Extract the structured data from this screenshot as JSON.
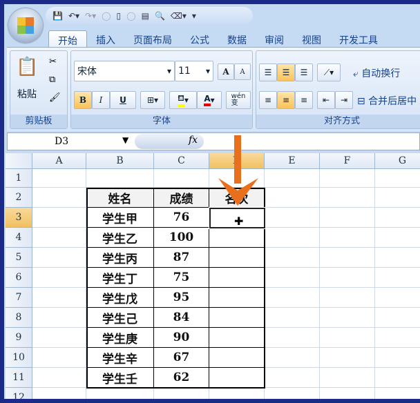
{
  "quick_access": {
    "icons": [
      "save-icon",
      "undo-icon",
      "redo-icon",
      "circle-icon",
      "new-icon",
      "open-icon",
      "form-icon",
      "print-preview-icon",
      "eraser-icon",
      "customize-icon"
    ]
  },
  "tabs": [
    "开始",
    "插入",
    "页面布局",
    "公式",
    "数据",
    "审阅",
    "视图",
    "开发工具"
  ],
  "ribbon": {
    "clipboard": {
      "label": "剪贴板",
      "paste": "粘贴"
    },
    "font": {
      "label": "字体",
      "name": "宋体",
      "size": "11",
      "bold": "B",
      "italic": "I",
      "underline": "U",
      "grow": "A",
      "shrink": "A",
      "color_a": "A",
      "phonetic": "wén\n变"
    },
    "alignment": {
      "label": "对齐方式",
      "wrap": "自动换行",
      "merge": "合并后居中"
    }
  },
  "formula_bar": {
    "name_box": "D3",
    "fx": "fx",
    "value": ""
  },
  "sheet": {
    "columns": [
      "A",
      "B",
      "C",
      "D",
      "E",
      "F",
      "G"
    ],
    "rows": [
      "1",
      "2",
      "3",
      "4",
      "5",
      "6",
      "7",
      "8",
      "9",
      "10",
      "11",
      "12"
    ],
    "selected_cell": "D3",
    "table": {
      "headers": [
        "姓名",
        "成绩",
        "名次"
      ],
      "rows": [
        [
          "学生甲",
          "76",
          ""
        ],
        [
          "学生乙",
          "100",
          ""
        ],
        [
          "学生丙",
          "87",
          ""
        ],
        [
          "学生丁",
          "75",
          ""
        ],
        [
          "学生戊",
          "95",
          ""
        ],
        [
          "学生己",
          "84",
          ""
        ],
        [
          "学生庚",
          "90",
          ""
        ],
        [
          "学生辛",
          "67",
          ""
        ],
        [
          "学生壬",
          "62",
          ""
        ]
      ]
    }
  },
  "colors": {
    "frame": "#1c2a8a",
    "arrow": "#e8701c",
    "selection_header": "#f1c15f"
  }
}
